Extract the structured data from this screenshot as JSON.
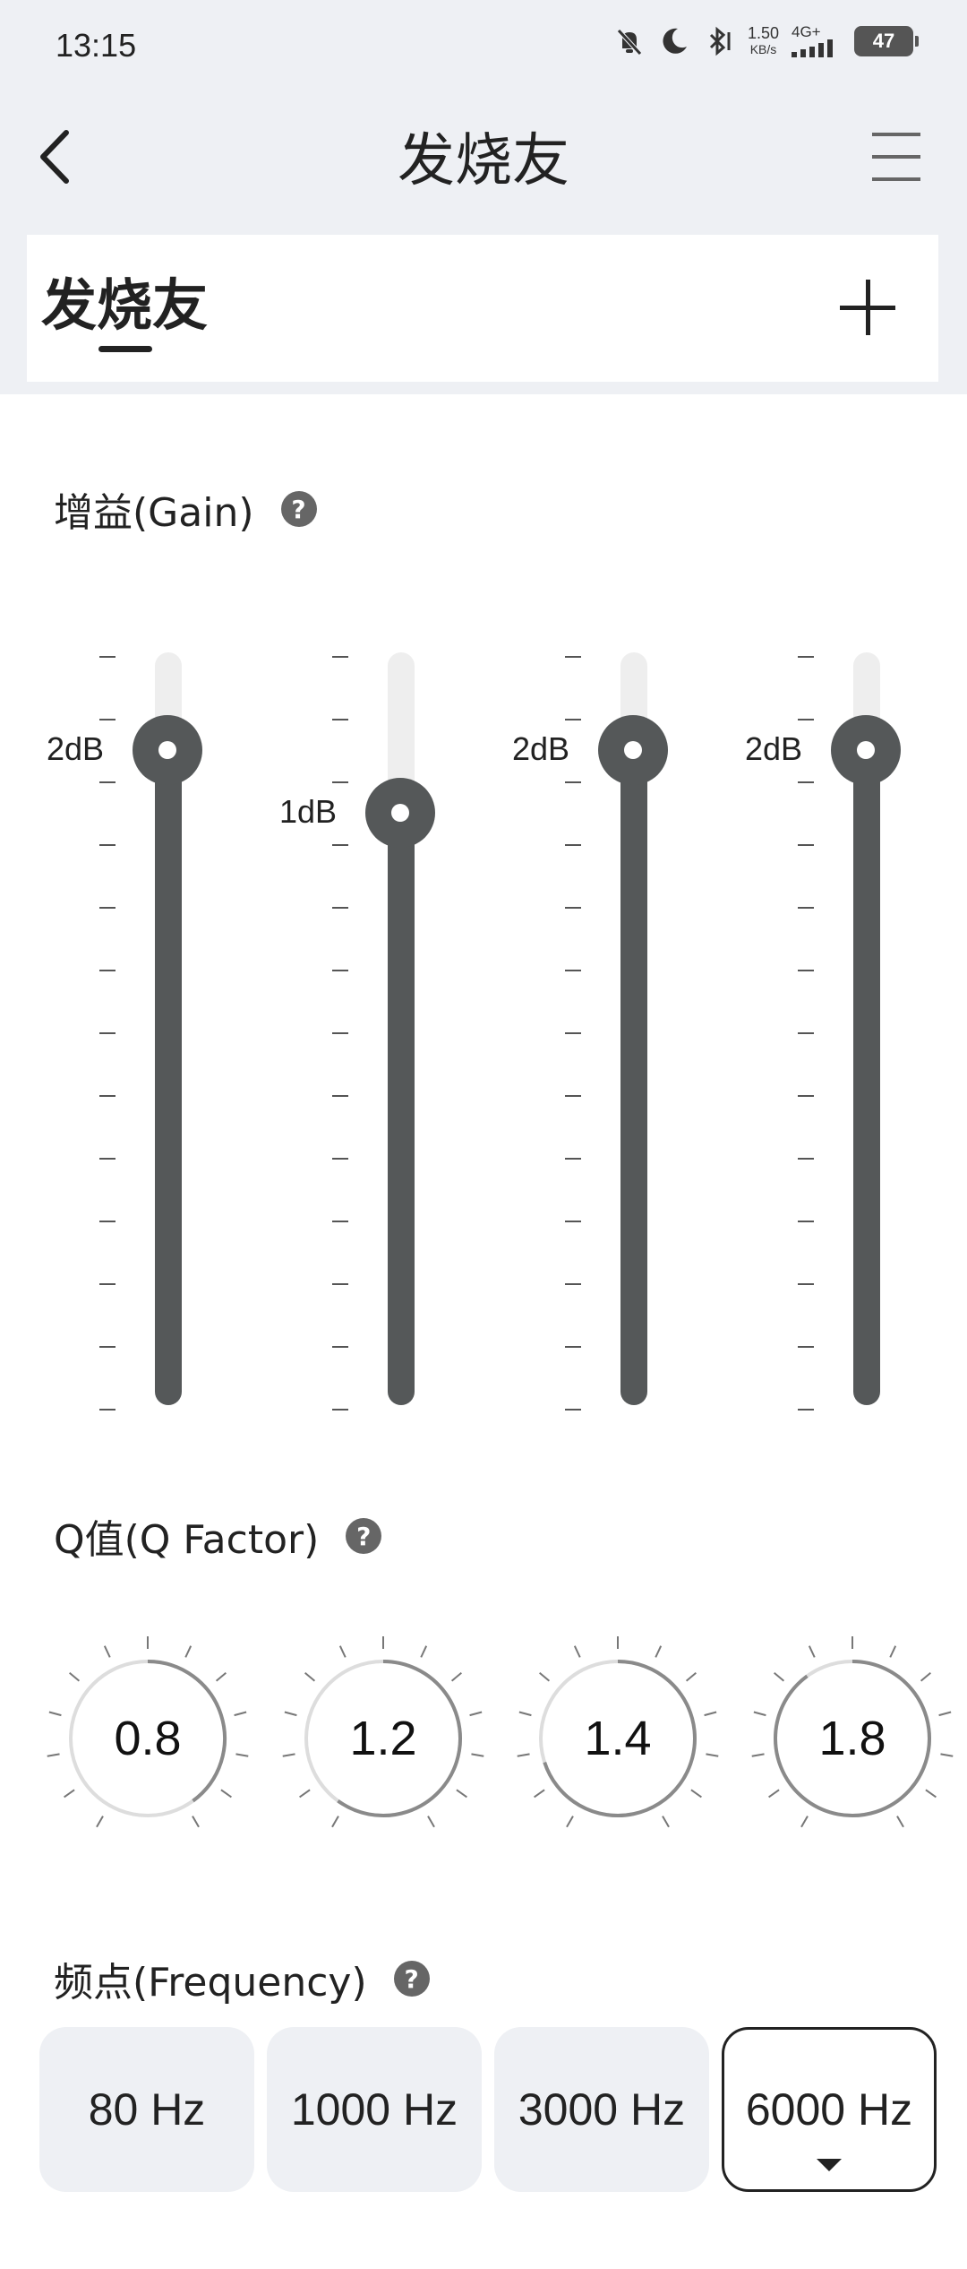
{
  "status_bar": {
    "time": "13:15",
    "net_speed_value": "1.50",
    "net_speed_unit": "KB/s",
    "network": "4G+",
    "battery": "47"
  },
  "nav": {
    "title": "发烧友"
  },
  "tabs": [
    {
      "label": "发烧友",
      "selected": true
    }
  ],
  "gain": {
    "title": "增益(Gain)",
    "bands": [
      {
        "label": "2dB",
        "value_db": 2
      },
      {
        "label": "1dB",
        "value_db": 1
      },
      {
        "label": "2dB",
        "value_db": 2
      },
      {
        "label": "2dB",
        "value_db": 2
      }
    ]
  },
  "q_factor": {
    "title": "Q值(Q Factor)",
    "values": [
      "0.8",
      "1.2",
      "1.4",
      "1.8"
    ]
  },
  "frequency": {
    "title": "频点(Frequency)",
    "options": [
      "80 Hz",
      "1000 Hz",
      "3000 Hz",
      "6000 Hz"
    ],
    "selected_index": 3
  },
  "colors": {
    "accent": "#555859",
    "track": "#eeeeee",
    "background": "#eef0f4"
  }
}
